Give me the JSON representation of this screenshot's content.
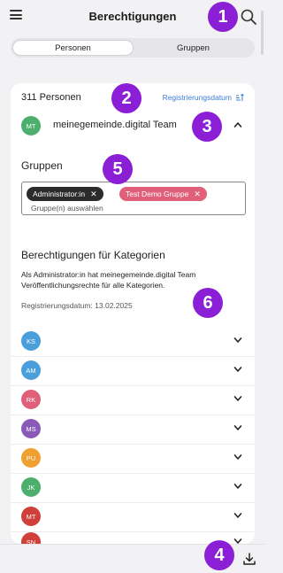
{
  "header": {
    "title": "Berechtigungen"
  },
  "tabs": [
    {
      "label": "Personen",
      "active": true
    },
    {
      "label": "Gruppen",
      "active": false
    }
  ],
  "list": {
    "count": "311 Personen",
    "sort_label": "Registrierungsdatum",
    "expanded_person": {
      "initials": "MT",
      "name": "meinegemeinde.digital Team",
      "color": "#4caf6d"
    },
    "groups_section": {
      "heading": "Gruppen",
      "chips": [
        {
          "label": "Administrator:in",
          "color": "#2b2b2b"
        },
        {
          "label": "Test Demo Gruppe",
          "color": "#e0607a"
        }
      ],
      "placeholder": "Gruppe(n) auswählen"
    },
    "categories_section": {
      "heading": "Berechtigungen für Kategorien",
      "text": "Als Administrator:in hat meinegemeinde.digital Team Veröffentlichungsrechte für alle Kategorien.",
      "registration": "Registrierungsdatum: 13.02.2025"
    },
    "people": [
      {
        "initials": "KS",
        "color": "#4a9fdb"
      },
      {
        "initials": "AM",
        "color": "#4a9fdb"
      },
      {
        "initials": "RK",
        "color": "#e0607a"
      },
      {
        "initials": "MS",
        "color": "#8a5ab8"
      },
      {
        "initials": "PU",
        "color": "#f0a030"
      },
      {
        "initials": "JK",
        "color": "#4caf6d"
      },
      {
        "initials": "MT",
        "color": "#d0403a"
      },
      {
        "initials": "SN",
        "color": "#d0403a"
      }
    ]
  },
  "badges": [
    "1",
    "2",
    "3",
    "4",
    "5",
    "6"
  ],
  "colors": {
    "accent": "#3b7ed6",
    "badge": "#8a1fd6"
  }
}
